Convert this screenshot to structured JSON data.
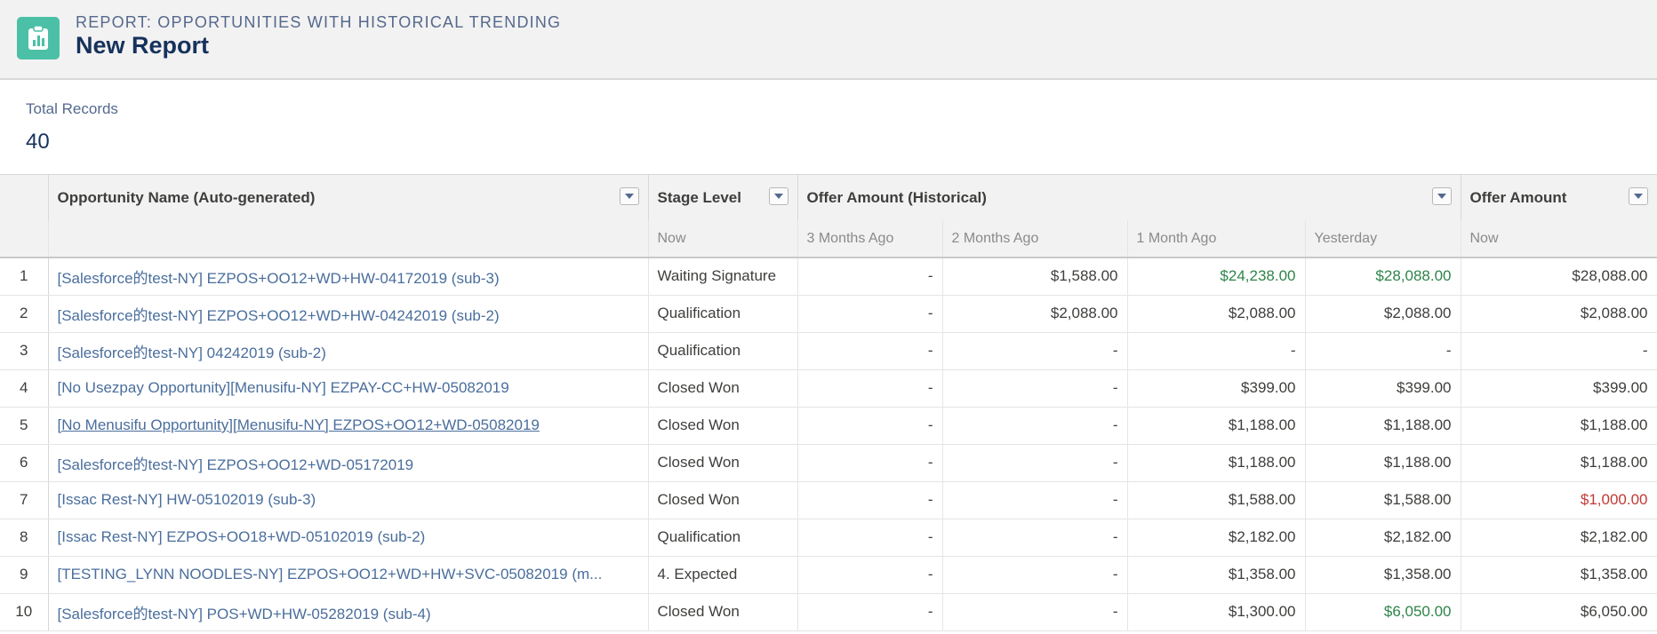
{
  "header": {
    "subtitle": "REPORT: OPPORTUNITIES WITH HISTORICAL TRENDING",
    "title": "New Report",
    "icon": "report-icon"
  },
  "summary": {
    "label": "Total Records",
    "value": "40"
  },
  "columns": {
    "opportunity_name": "Opportunity Name (Auto-generated)",
    "stage_level": "Stage Level",
    "stage_now": "Now",
    "offer_historical": "Offer Amount (Historical)",
    "months3": "3 Months Ago",
    "months2": "2 Months Ago",
    "month1": "1 Month Ago",
    "yesterday": "Yesterday",
    "offer_amount": "Offer Amount",
    "offer_now": "Now"
  },
  "colors": {
    "increase": "#2e844a",
    "decrease": "#c23934",
    "link": "#4a6e9c"
  },
  "rows": [
    {
      "n": "1",
      "name": "[Salesforce的test-NY] EZPOS+OO12+WD+HW-04172019 (sub-3)",
      "stage": "Waiting Signature",
      "m3": "-",
      "m2": "$1,588.00",
      "m1": "$24,238.00",
      "y": "$28,088.00",
      "now": "$28,088.00"
    },
    {
      "n": "2",
      "name": "[Salesforce的test-NY] EZPOS+OO12+WD+HW-04242019 (sub-2)",
      "stage": "Qualification",
      "m3": "-",
      "m2": "$2,088.00",
      "m1": "$2,088.00",
      "y": "$2,088.00",
      "now": "$2,088.00"
    },
    {
      "n": "3",
      "name": "[Salesforce的test-NY] 04242019 (sub-2)",
      "stage": "Qualification",
      "m3": "-",
      "m2": "-",
      "m1": "-",
      "y": "-",
      "now": "-"
    },
    {
      "n": "4",
      "name": "[No Usezpay Opportunity][Menusifu-NY] EZPAY-CC+HW-05082019",
      "stage": "Closed Won",
      "m3": "-",
      "m2": "-",
      "m1": "$399.00",
      "y": "$399.00",
      "now": "$399.00"
    },
    {
      "n": "5",
      "name": "[No Menusifu Opportunity][Menusifu-NY] EZPOS+OO12+WD-05082019",
      "stage": "Closed Won",
      "m3": "-",
      "m2": "-",
      "m1": "$1,188.00",
      "y": "$1,188.00",
      "now": "$1,188.00"
    },
    {
      "n": "6",
      "name": "[Salesforce的test-NY] EZPOS+OO12+WD-05172019",
      "stage": "Closed Won",
      "m3": "-",
      "m2": "-",
      "m1": "$1,188.00",
      "y": "$1,188.00",
      "now": "$1,188.00"
    },
    {
      "n": "7",
      "name": "[Issac Rest-NY] HW-05102019 (sub-3)",
      "stage": "Closed Won",
      "m3": "-",
      "m2": "-",
      "m1": "$1,588.00",
      "y": "$1,588.00",
      "now": "$1,000.00"
    },
    {
      "n": "8",
      "name": "[Issac Rest-NY] EZPOS+OO18+WD-05102019 (sub-2)",
      "stage": "Qualification",
      "m3": "-",
      "m2": "-",
      "m1": "$2,182.00",
      "y": "$2,182.00",
      "now": "$2,182.00"
    },
    {
      "n": "9",
      "name": "[TESTING_LYNN NOODLES-NY] EZPOS+OO12+WD+HW+SVC-05082019 (m...",
      "stage": "4. Expected",
      "m3": "-",
      "m2": "-",
      "m1": "$1,358.00",
      "y": "$1,358.00",
      "now": "$1,358.00"
    },
    {
      "n": "10",
      "name": "[Salesforce的test-NY] POS+WD+HW-05282019 (sub-4)",
      "stage": "Closed Won",
      "m3": "-",
      "m2": "-",
      "m1": "$1,300.00",
      "y": "$6,050.00",
      "now": "$6,050.00"
    }
  ]
}
